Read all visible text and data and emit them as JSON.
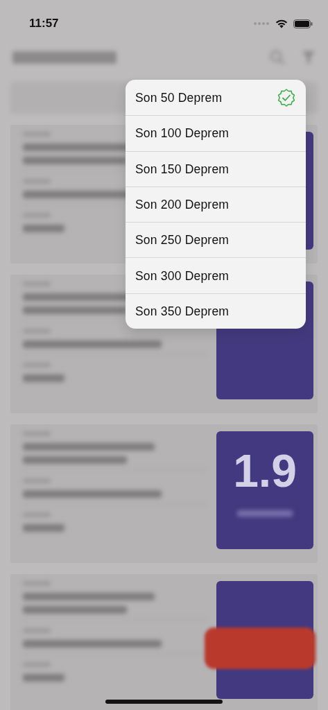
{
  "status_bar": {
    "time": "11:57"
  },
  "background_list": {
    "visible_magnitude": "1.9"
  },
  "menu": {
    "items": [
      {
        "label": "Son 50 Deprem",
        "selected": true
      },
      {
        "label": "Son 100 Deprem",
        "selected": false
      },
      {
        "label": "Son 150 Deprem",
        "selected": false
      },
      {
        "label": "Son 200 Deprem",
        "selected": false
      },
      {
        "label": "Son 250 Deprem",
        "selected": false
      },
      {
        "label": "Son 300 Deprem",
        "selected": false
      },
      {
        "label": "Son 350 Deprem",
        "selected": false
      }
    ]
  }
}
